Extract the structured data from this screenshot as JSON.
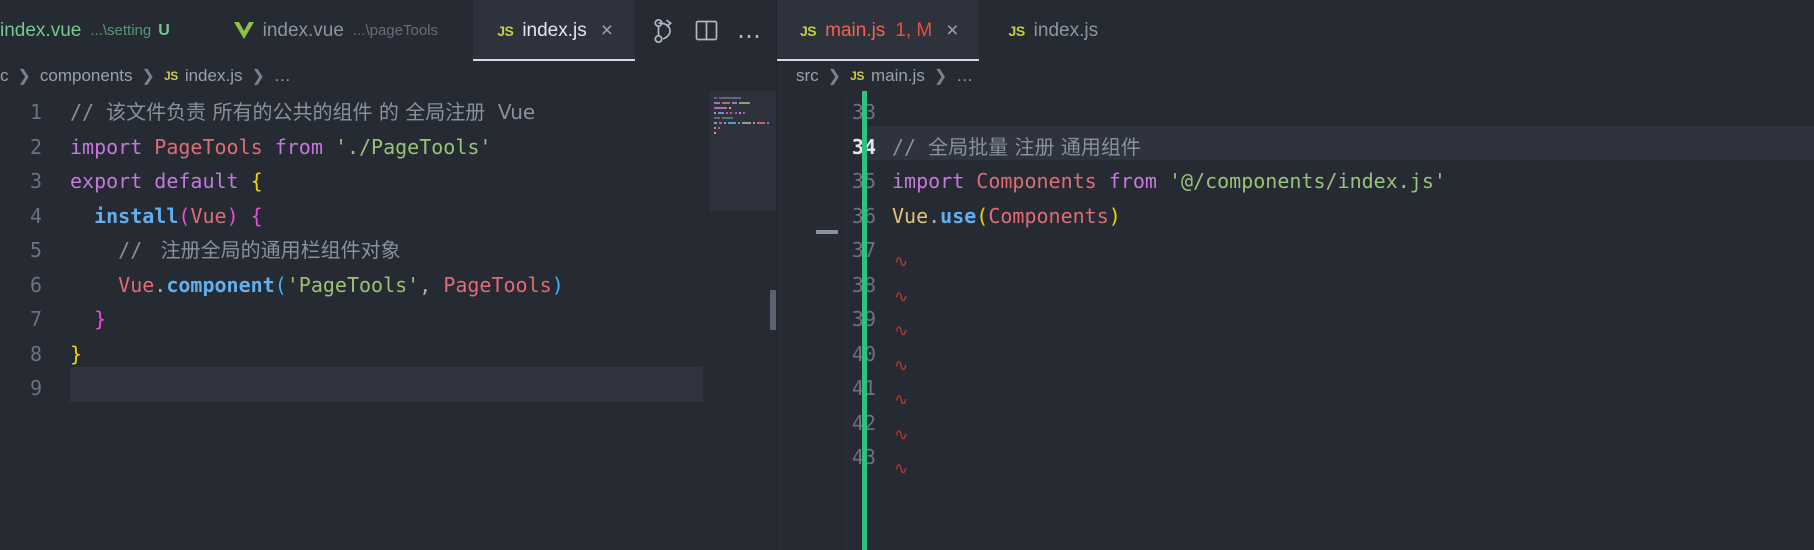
{
  "window": {
    "theme": "dark",
    "accent": "#61afef",
    "background": "#252a33"
  },
  "editor_group_left": {
    "tabs": [
      {
        "name": "index.vue",
        "description": "...\\setting",
        "badge": "U",
        "icon": "vue-icon",
        "active": false,
        "state": "untracked",
        "color": "#73c991",
        "truncated_left": true
      },
      {
        "name": "index.vue",
        "description": "...\\pageTools",
        "badge": "",
        "icon": "vue-icon",
        "active": false,
        "state": "inactive",
        "color": "#8d95a1"
      },
      {
        "name": "index.js",
        "description": "",
        "badge": "",
        "icon": "js-icon",
        "active": true,
        "state": "active",
        "color": "#e4e7ec",
        "close_label": "×"
      }
    ],
    "actions": [
      {
        "name": "split-changes-icon",
        "label": ""
      },
      {
        "name": "split-editor-icon",
        "label": ""
      },
      {
        "name": "more-actions-icon",
        "label": "…"
      }
    ],
    "breadcrumb": [
      {
        "label": "c",
        "icon": "",
        "truncated": true
      },
      {
        "label": "components",
        "icon": ""
      },
      {
        "label": "index.js",
        "icon": "js-icon"
      },
      {
        "label": "…",
        "icon": ""
      }
    ],
    "code": {
      "language": "javascript",
      "first_line": 1,
      "cursor_line": 9,
      "lines": [
        {
          "n": 1,
          "tokens": [
            {
              "t": "// ",
              "c": "t-comment"
            },
            {
              "t": "该文件负责 所有的公共的组件 的 全局注册  Vue",
              "c": "t-comment cjk"
            }
          ]
        },
        {
          "n": 2,
          "tokens": [
            {
              "t": "import ",
              "c": "t-kw"
            },
            {
              "t": "PageTools ",
              "c": "t-var"
            },
            {
              "t": "from ",
              "c": "t-kw"
            },
            {
              "t": "'./PageTools'",
              "c": "t-str"
            }
          ]
        },
        {
          "n": 3,
          "tokens": [
            {
              "t": "export default ",
              "c": "t-kw"
            },
            {
              "t": "{",
              "c": "t-punc-y"
            }
          ]
        },
        {
          "n": 4,
          "tokens": [
            {
              "t": "  ",
              "c": "t-plain"
            },
            {
              "t": "install",
              "c": "t-fn"
            },
            {
              "t": "(",
              "c": "t-punc-m"
            },
            {
              "t": "Vue",
              "c": "t-var"
            },
            {
              "t": ")",
              "c": "t-punc-m"
            },
            {
              "t": " ",
              "c": "t-plain"
            },
            {
              "t": "{",
              "c": "t-punc-m"
            }
          ]
        },
        {
          "n": 5,
          "tokens": [
            {
              "t": "    // ",
              "c": "t-comment"
            },
            {
              "t": " 注册全局的通用栏组件对象",
              "c": "t-comment cjk"
            }
          ]
        },
        {
          "n": 6,
          "tokens": [
            {
              "t": "    ",
              "c": "t-plain"
            },
            {
              "t": "Vue",
              "c": "t-var"
            },
            {
              "t": ".",
              "c": "t-plain"
            },
            {
              "t": "component",
              "c": "t-prop"
            },
            {
              "t": "(",
              "c": "t-punc-b"
            },
            {
              "t": "'PageTools'",
              "c": "t-str"
            },
            {
              "t": ", ",
              "c": "t-plain"
            },
            {
              "t": "PageTools",
              "c": "t-var"
            },
            {
              "t": ")",
              "c": "t-punc-b"
            }
          ]
        },
        {
          "n": 7,
          "tokens": [
            {
              "t": "  ",
              "c": "t-plain"
            },
            {
              "t": "}",
              "c": "t-punc-m"
            }
          ]
        },
        {
          "n": 8,
          "tokens": [
            {
              "t": "}",
              "c": "t-punc-y"
            }
          ]
        },
        {
          "n": 9,
          "tokens": []
        }
      ]
    }
  },
  "editor_group_right": {
    "tabs": [
      {
        "name": "main.js",
        "description": "",
        "badge": "1, M",
        "icon": "js-icon",
        "active": true,
        "state": "error-modified",
        "color": "#f0654c",
        "close_label": "×"
      },
      {
        "name": "index.js",
        "description": "",
        "badge": "",
        "icon": "js-icon",
        "active": false,
        "state": "inactive",
        "color": "#8d95a1"
      }
    ],
    "breadcrumb": [
      {
        "label": "src",
        "icon": ""
      },
      {
        "label": "main.js",
        "icon": "js-icon"
      },
      {
        "label": "…",
        "icon": ""
      }
    ],
    "code": {
      "language": "javascript",
      "first_line": 33,
      "cursor_line": 34,
      "change_indicator_color": "#2ec27e",
      "lines": [
        {
          "n": 33,
          "tokens": []
        },
        {
          "n": 34,
          "active": true,
          "tokens": [
            {
              "t": "// ",
              "c": "t-comment"
            },
            {
              "t": "全局批量 注册 通用组件",
              "c": "t-comment cjk"
            }
          ]
        },
        {
          "n": 35,
          "tokens": [
            {
              "t": "import ",
              "c": "t-kw"
            },
            {
              "t": "Components ",
              "c": "t-var"
            },
            {
              "t": "from ",
              "c": "t-kw"
            },
            {
              "t": "'@/components/index.js'",
              "c": "t-str"
            }
          ]
        },
        {
          "n": 36,
          "tokens": [
            {
              "t": "Vue",
              "c": "t-obj"
            },
            {
              "t": ".",
              "c": "t-plain"
            },
            {
              "t": "use",
              "c": "t-prop"
            },
            {
              "t": "(",
              "c": "t-punc-y"
            },
            {
              "t": "Components",
              "c": "t-var"
            },
            {
              "t": ")",
              "c": "t-punc-y"
            }
          ]
        },
        {
          "n": 37,
          "tokens": [],
          "squiggle": true
        },
        {
          "n": 38,
          "tokens": [],
          "squiggle": true
        },
        {
          "n": 39,
          "tokens": [],
          "squiggle": true
        },
        {
          "n": 40,
          "tokens": [],
          "squiggle": true
        },
        {
          "n": 41,
          "tokens": [],
          "squiggle": true
        },
        {
          "n": 42,
          "tokens": [],
          "squiggle": true
        },
        {
          "n": 43,
          "tokens": [],
          "squiggle": true
        }
      ]
    }
  }
}
